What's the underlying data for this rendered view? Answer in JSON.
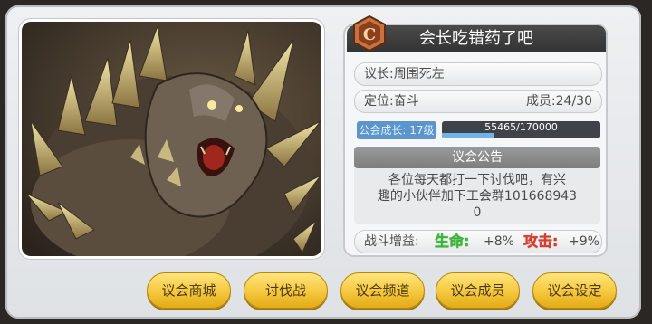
{
  "guild": {
    "name": "会长吃错药了吧",
    "rank_letter": "C",
    "leader": "议长:周围死左",
    "role": "定位:奋斗",
    "members": "成员:24/30",
    "growth_label": "公会成长: 17级",
    "growth_value": "55465/170000",
    "growth_fraction": 0.326
  },
  "notice": {
    "title": "议会公告",
    "lines": [
      "各位每天都打一下讨伐吧，有兴",
      "趣的小伙伴加下工会群101668943",
      "0"
    ]
  },
  "buffs": {
    "label": "战斗增益:",
    "hp_label": "生命:",
    "hp_value": "+8%",
    "atk_label": "攻击:",
    "atk_value": "+9%"
  },
  "buttons": [
    "议会商城",
    "讨伐战",
    "议会频道",
    "议会成员",
    "议会设定"
  ],
  "colors": {
    "button": "#f5c73d",
    "title_bar": "#3b3b3b",
    "growth": "#5b95c9",
    "hp": "#2fbf2f",
    "atk": "#e23a2a"
  }
}
